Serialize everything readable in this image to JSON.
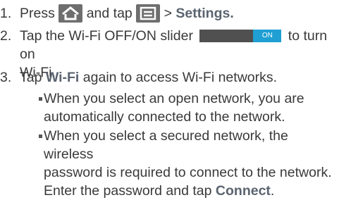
{
  "steps": [
    {
      "number": "1.",
      "parts": [
        "Press",
        "and tap",
        ">",
        "Settings."
      ],
      "icons": [
        "home-icon",
        "menu-icon"
      ]
    },
    {
      "number": "2.",
      "text_before": "Tap the Wi-Fi OFF/ON slider",
      "slider_label": "ON",
      "text_after": "to turn on",
      "text_line2": "Wi-Fi."
    },
    {
      "number": "3.",
      "text_before": "Tap",
      "bold": "Wi-Fi",
      "text_after": "again to access Wi-Fi networks."
    }
  ],
  "bullets": [
    {
      "line1": "When you select an open network, you are",
      "line2": "automatically connected to the network."
    },
    {
      "line1": "When you select a secured network, the wireless",
      "line2": "password is required to connect to the network.",
      "line3_before": "Enter the password and tap",
      "line3_bold": "Connect",
      "line3_after": "."
    }
  ],
  "colors": {
    "slider_on": "#1f9fd3",
    "slider_off": "#505050",
    "icon_bg": "#6e6e6e"
  }
}
